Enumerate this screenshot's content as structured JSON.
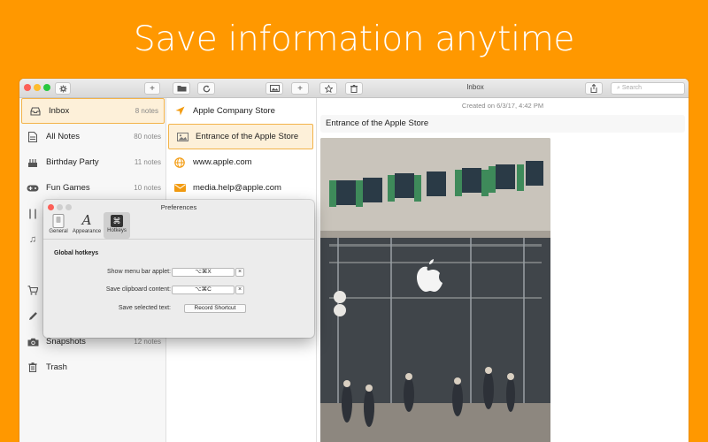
{
  "headline": "Save information anytime",
  "window": {
    "title": "Inbox",
    "search_placeholder": "Search"
  },
  "sidebar": {
    "items": [
      {
        "label": "Inbox",
        "count": "8 notes",
        "icon": "tray-icon"
      },
      {
        "label": "All Notes",
        "count": "80 notes",
        "icon": "document-icon"
      },
      {
        "label": "Birthday Party",
        "count": "11 notes",
        "icon": "cake-icon"
      },
      {
        "label": "Fun Games",
        "count": "10 notes",
        "icon": "gamepad-icon"
      },
      {
        "label": "Snapshots",
        "count": "12 notes",
        "icon": "camera-icon"
      },
      {
        "label": "Trash",
        "count": "",
        "icon": "trash-icon"
      }
    ]
  },
  "notes": {
    "items": [
      {
        "label": "Apple Company Store",
        "icon": "location-arrow-icon"
      },
      {
        "label": "Entrance of the Apple Store",
        "icon": "image-icon"
      },
      {
        "label": "www.apple.com",
        "icon": "globe-icon"
      },
      {
        "label": "media.help@apple.com",
        "icon": "envelope-icon"
      }
    ]
  },
  "detail": {
    "created": "Created on 6/3/17, 4:42 PM",
    "title": "Entrance of the Apple Store"
  },
  "prefs": {
    "title": "Preferences",
    "tabs": [
      {
        "label": "General",
        "icon": "switch-icon"
      },
      {
        "label": "Appearance",
        "icon": "font-a-icon"
      },
      {
        "label": "Hotkeys",
        "icon": "command-key-icon"
      }
    ],
    "section": "Global hotkeys",
    "rows": [
      {
        "label": "Show menu bar applet:",
        "value": "⌥⌘X"
      },
      {
        "label": "Save clipboard content:",
        "value": "⌥⌘C"
      },
      {
        "label": "Save selected text:",
        "value": "Record Shortcut"
      }
    ],
    "clear_glyph": "×"
  },
  "colors": {
    "background": "#FF9800",
    "accent": "#F39C12",
    "selection": "#FDF0D9"
  }
}
